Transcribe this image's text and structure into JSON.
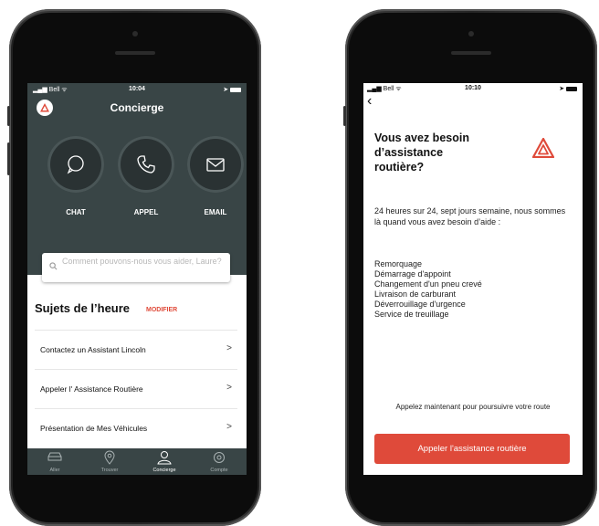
{
  "left": {
    "status": {
      "carrier": "Bell",
      "time": "10:04"
    },
    "title": "Concierge",
    "actions": [
      {
        "label": "CHAT",
        "icon": "chat-bubble-icon"
      },
      {
        "label": "APPEL",
        "icon": "phone-icon"
      },
      {
        "label": "EMAIL",
        "icon": "envelope-icon"
      }
    ],
    "search": {
      "placeholder": "Comment pouvons-nous vous aider, Laure?"
    },
    "section": {
      "title": "Sujets de l’heure",
      "edit": "MODIFIER"
    },
    "topics": [
      {
        "label": "Contactez un Assistant Lincoln"
      },
      {
        "label": "Appeler l' Assistance Routière"
      },
      {
        "label": "Présentation de Mes Véhicules"
      }
    ],
    "tabs": [
      {
        "label": "Aller",
        "icon": "car-icon"
      },
      {
        "label": "Trouver",
        "icon": "location-pin-icon"
      },
      {
        "label": "Concierge",
        "icon": "concierge-person-icon"
      },
      {
        "label": "Compte",
        "icon": "gear-icon"
      }
    ],
    "active_tab": "Concierge"
  },
  "right": {
    "status": {
      "carrier": "Bell",
      "time": "10:10"
    },
    "title": "Vous avez besoin d’assistance routière?",
    "description": "24 heures sur 24, sept jours semaine, nous sommes là quand vous avez besoin d’aide :",
    "services": [
      "Remorquage",
      "Démarrage d'appoint",
      "Changement d'un pneu crevé",
      "Livraison de carburant",
      "Déverrouillage d'urgence",
      "Service de treuillage"
    ],
    "note": "Appelez maintenant pour poursuivre votre route",
    "button": "Appeler l'assistance routière"
  },
  "colors": {
    "dark": "#394546",
    "accent": "#df4a3a"
  }
}
